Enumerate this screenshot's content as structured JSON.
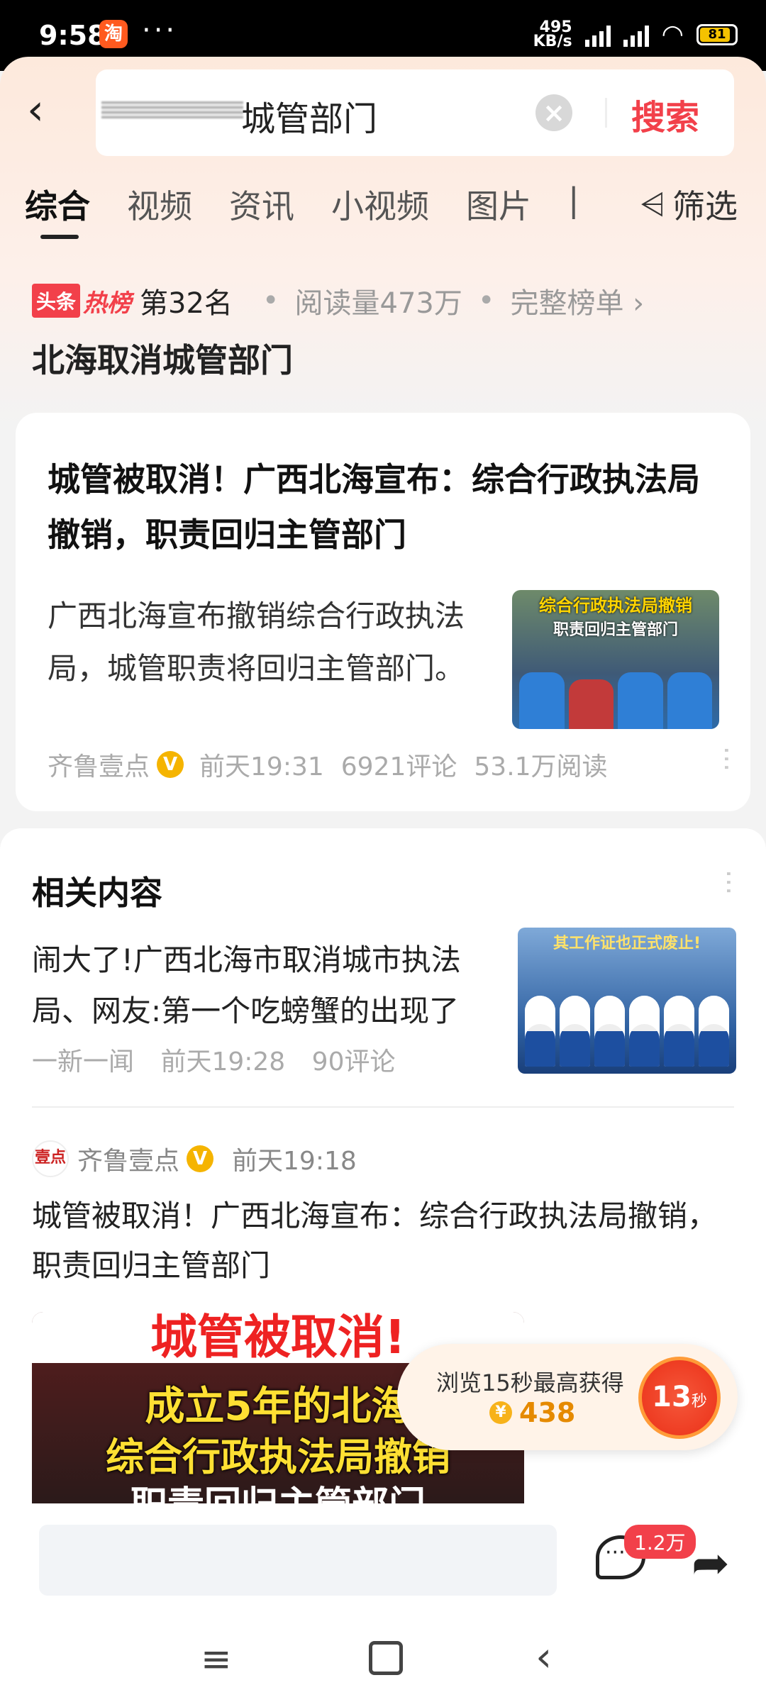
{
  "status_bar": {
    "time": "9:58",
    "app_icon": "淘",
    "dots": "···",
    "speed_value": "495",
    "speed_unit": "KB/s",
    "battery": "81"
  },
  "search": {
    "query": "城管部门",
    "search_button": "搜索"
  },
  "tabs": [
    {
      "label": "综合"
    },
    {
      "label": "视频"
    },
    {
      "label": "资讯"
    },
    {
      "label": "小视频"
    },
    {
      "label": "图片"
    },
    {
      "label": "|"
    }
  ],
  "filter_label": "筛选",
  "hot": {
    "logo_a": "头条",
    "logo_b": "热榜",
    "rank": "第32名",
    "reads": "阅读量473万",
    "full_list": "完整榜单 ›",
    "title": "北海取消城管部门"
  },
  "top_article": {
    "title": "城管被取消！广西北海宣布：综合行政执法局撤销，职责回归主管部门",
    "summary": "广西北海宣布撤销综合行政执法局，城管职责将回归主管部门。",
    "image_caption_1": "综合行政执法局撤销",
    "image_caption_2": "职责回归主管部门",
    "author": "齐鲁壹点",
    "time": "前天19:31",
    "comments": "6921评论",
    "reads": "53.1万阅读"
  },
  "related": {
    "heading": "相关内容",
    "item1": {
      "title": "闹大了!广西北海市取消城市执法局、网友:第一个吃螃蟹的出现了",
      "source": "一新一闻",
      "time": "前天19:28",
      "comments": "90评论",
      "image_caption": "其工作证也正式废止!"
    },
    "item2": {
      "avatar": "壹点",
      "author": "齐鲁壹点",
      "time": "前天19:18",
      "title": "城管被取消！广西北海宣布：综合行政执法局撤销，职责回归主管部门",
      "image_line1": "城管被取消!",
      "image_line2": "成立5年的北海",
      "image_line3": "综合行政执法局撤销",
      "image_line4": "职责回归主管部门"
    }
  },
  "reward": {
    "text": "浏览15秒最高获得",
    "coin_symbol": "¥",
    "coins": "438",
    "timer": "13",
    "timer_unit": "秒"
  },
  "bottom_bar": {
    "comment_count": "1.2万"
  }
}
